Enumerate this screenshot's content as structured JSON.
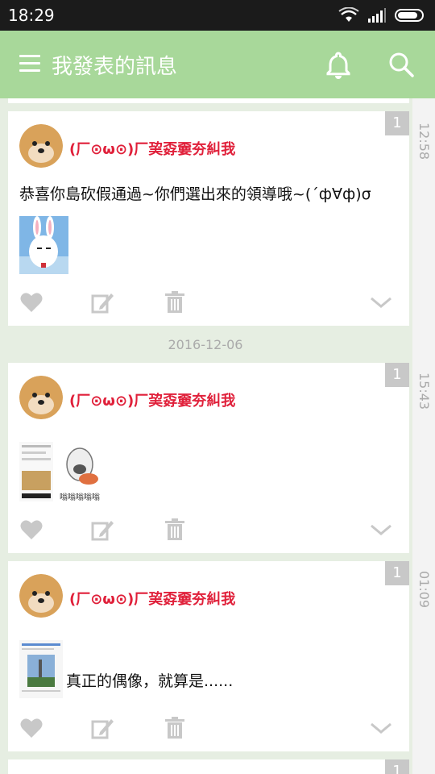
{
  "status_bar": {
    "time": "18:29"
  },
  "app_bar": {
    "title": "我發表的訊息"
  },
  "icons": {
    "menu": "menu-icon",
    "bell": "bell-icon",
    "search": "search-icon",
    "like": "heart-icon",
    "edit": "edit-icon",
    "delete": "trash-icon",
    "expand": "chevron-down-icon"
  },
  "colors": {
    "app_bar": "#a8d89a",
    "username": "#e0203a",
    "background": "#e6eee2"
  },
  "posts": [
    {
      "badge": "1",
      "username": "(厂⊙ω⊙)厂巭孬嫑夯糾我",
      "text": "恭喜你島砍假通過~你們選出來的領導哦~(´ф∀ф)σ",
      "time": "12:58"
    },
    {
      "badge": "1",
      "username": "(厂⊙ω⊙)厂巭孬嫑夯糾我",
      "text": "",
      "time": "15:43",
      "image_caption": "嗡嗡嗡嗡嗡"
    },
    {
      "badge": "1",
      "username": "(厂⊙ω⊙)厂巭孬嫑夯糾我",
      "text": "真正的偶像，就算是......",
      "time": "01:09"
    }
  ],
  "date_separator": "2016-12-06",
  "partial_card_badge": "1"
}
